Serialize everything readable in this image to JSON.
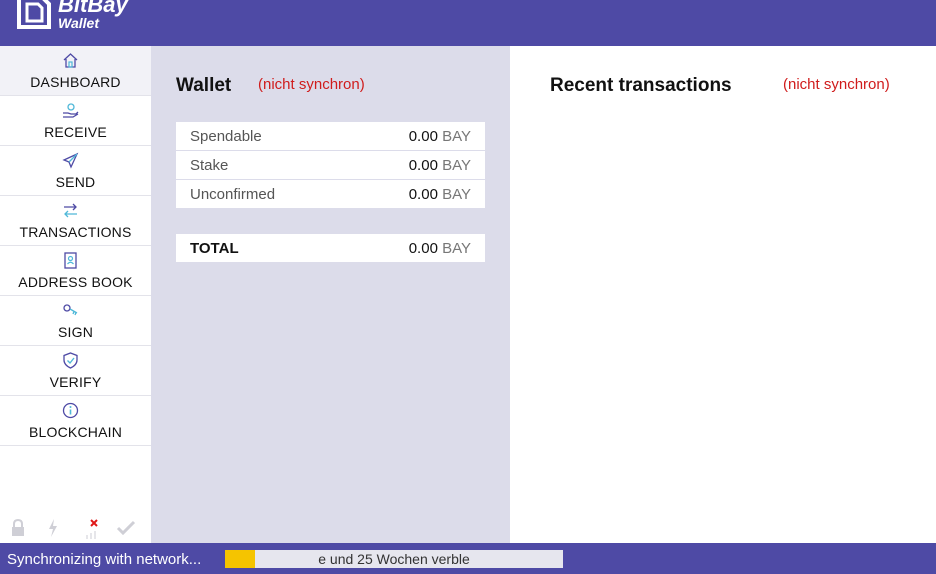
{
  "brand": {
    "name": "BitBay",
    "sub": "Wallet"
  },
  "nav": [
    {
      "label": "DASHBOARD",
      "icon": "home-icon",
      "active": true
    },
    {
      "label": "RECEIVE",
      "icon": "receive-hand-icon"
    },
    {
      "label": "SEND",
      "icon": "paper-plane-icon"
    },
    {
      "label": "TRANSACTIONS",
      "icon": "swap-arrows-icon"
    },
    {
      "label": "ADDRESS BOOK",
      "icon": "address-book-icon"
    },
    {
      "label": "SIGN",
      "icon": "key-icon"
    },
    {
      "label": "VERIFY",
      "icon": "shield-check-icon"
    },
    {
      "label": "BLOCKCHAIN",
      "icon": "info-circle-icon"
    }
  ],
  "status_icons": [
    "lock-icon",
    "lightning-icon",
    "network-error-icon",
    "checkmark-icon"
  ],
  "wallet": {
    "title": "Wallet",
    "sync_status": "(nicht synchron)",
    "rows": [
      {
        "label": "Spendable",
        "amount": "0.00",
        "unit": "BAY"
      },
      {
        "label": "Stake",
        "amount": "0.00",
        "unit": "BAY"
      },
      {
        "label": "Unconfirmed",
        "amount": "0.00",
        "unit": "BAY"
      }
    ],
    "total": {
      "label": "TOTAL",
      "amount": "0.00",
      "unit": "BAY"
    }
  },
  "recent": {
    "title": "Recent transactions",
    "sync_status": "(nicht synchron)"
  },
  "statusbar": {
    "text": "Synchronizing with network...",
    "progress_text": "e und 25 Wochen  verble",
    "progress_fraction": 0.09
  },
  "colors": {
    "brand": "#4e4aa5",
    "warning": "#d01c1c",
    "progress": "#f5c400",
    "icon_accent": "#4fb8d8"
  }
}
